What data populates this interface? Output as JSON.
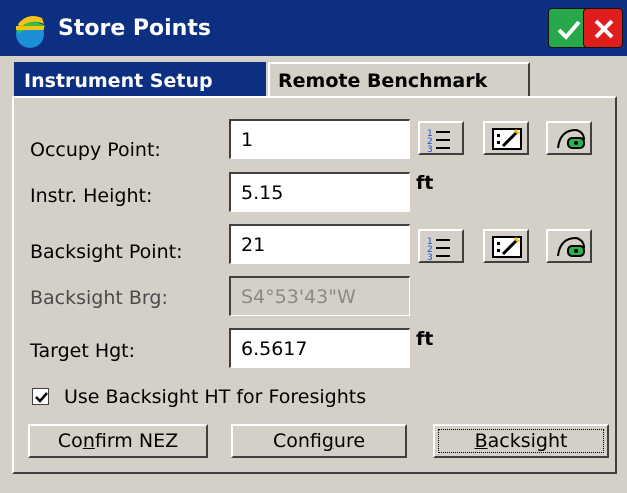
{
  "window": {
    "title": "Store Points",
    "ok_icon": "check-icon",
    "close_icon": "close-icon",
    "ok_color": "#27a84a",
    "close_color": "#e01d1d",
    "titlebar_color": "#0c2f82"
  },
  "tabs": [
    {
      "label": "Instrument Setup",
      "active": true
    },
    {
      "label": "Remote Benchmark",
      "active": false
    }
  ],
  "form": {
    "occupy_point": {
      "label": "Occupy Point:",
      "value": "1"
    },
    "instr_height": {
      "label": "Instr. Height:",
      "value": "5.15",
      "unit": "ft"
    },
    "backsight_point": {
      "label": "Backsight Point:",
      "value": "21"
    },
    "backsight_brg": {
      "label": "Backsight Brg:",
      "value": "S4°53'43\"W"
    },
    "target_hgt": {
      "label": "Target Hgt:",
      "value": "6.5617",
      "unit": "ft"
    }
  },
  "icon_buttons": [
    "list-icon",
    "map-select-icon",
    "survey-instrument-icon"
  ],
  "checkbox": {
    "label": "Use Backsight HT for Foresights",
    "checked": true
  },
  "buttons": {
    "confirm_pre": "Co",
    "confirm_u": "n",
    "confirm_post": "firm NEZ",
    "configure_pre": "Confi",
    "configure_u": "g",
    "configure_post": "ure",
    "backsight_u": "B",
    "backsight_post": "acksight"
  }
}
